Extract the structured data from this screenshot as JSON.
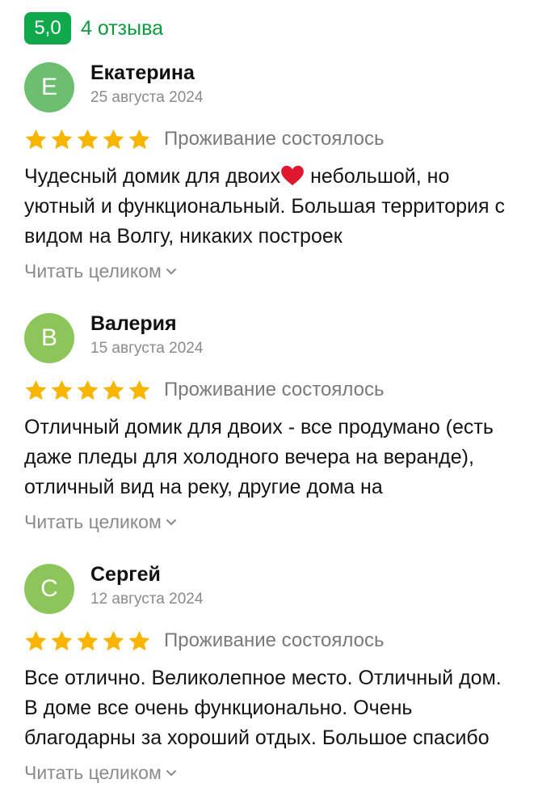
{
  "header": {
    "rating": "5,0",
    "reviews_count": "4 отзыва",
    "badge_color": "#0fa84a"
  },
  "reviews": [
    {
      "avatar_letter": "Е",
      "avatar_color": "#6bbf6e",
      "author": "Екатерина",
      "date": "25 августа 2024",
      "stars": 5,
      "status": "Проживание состоялось",
      "text_before_emoji": "Чудесный домик для двоих",
      "emoji": "heart-icon",
      "text_after_emoji": " небольшой, но уютный и функциональный. Большая территория с видом на Волгу, никаких построек",
      "read_more": "Читать целиком"
    },
    {
      "avatar_letter": "В",
      "avatar_color": "#8cc65a",
      "author": "Валерия",
      "date": "15 августа 2024",
      "stars": 5,
      "status": "Проживание состоялось",
      "text": "Отличный домик для двоих - все продумано (есть даже пледы для холодного вечера на веранде), отличный вид на реку, другие дома на",
      "read_more": "Читать целиком"
    },
    {
      "avatar_letter": "С",
      "avatar_color": "#8cc65a",
      "author": "Сергей",
      "date": "12 августа 2024",
      "stars": 5,
      "status": "Проживание состоялось",
      "text": "Все отлично. Великолепное место. Отличный дом. В доме все очень функционально. Очень благодарны за хороший отдых. Большое спасибо",
      "read_more": "Читать целиком"
    }
  ],
  "star_color": "#f7b500"
}
